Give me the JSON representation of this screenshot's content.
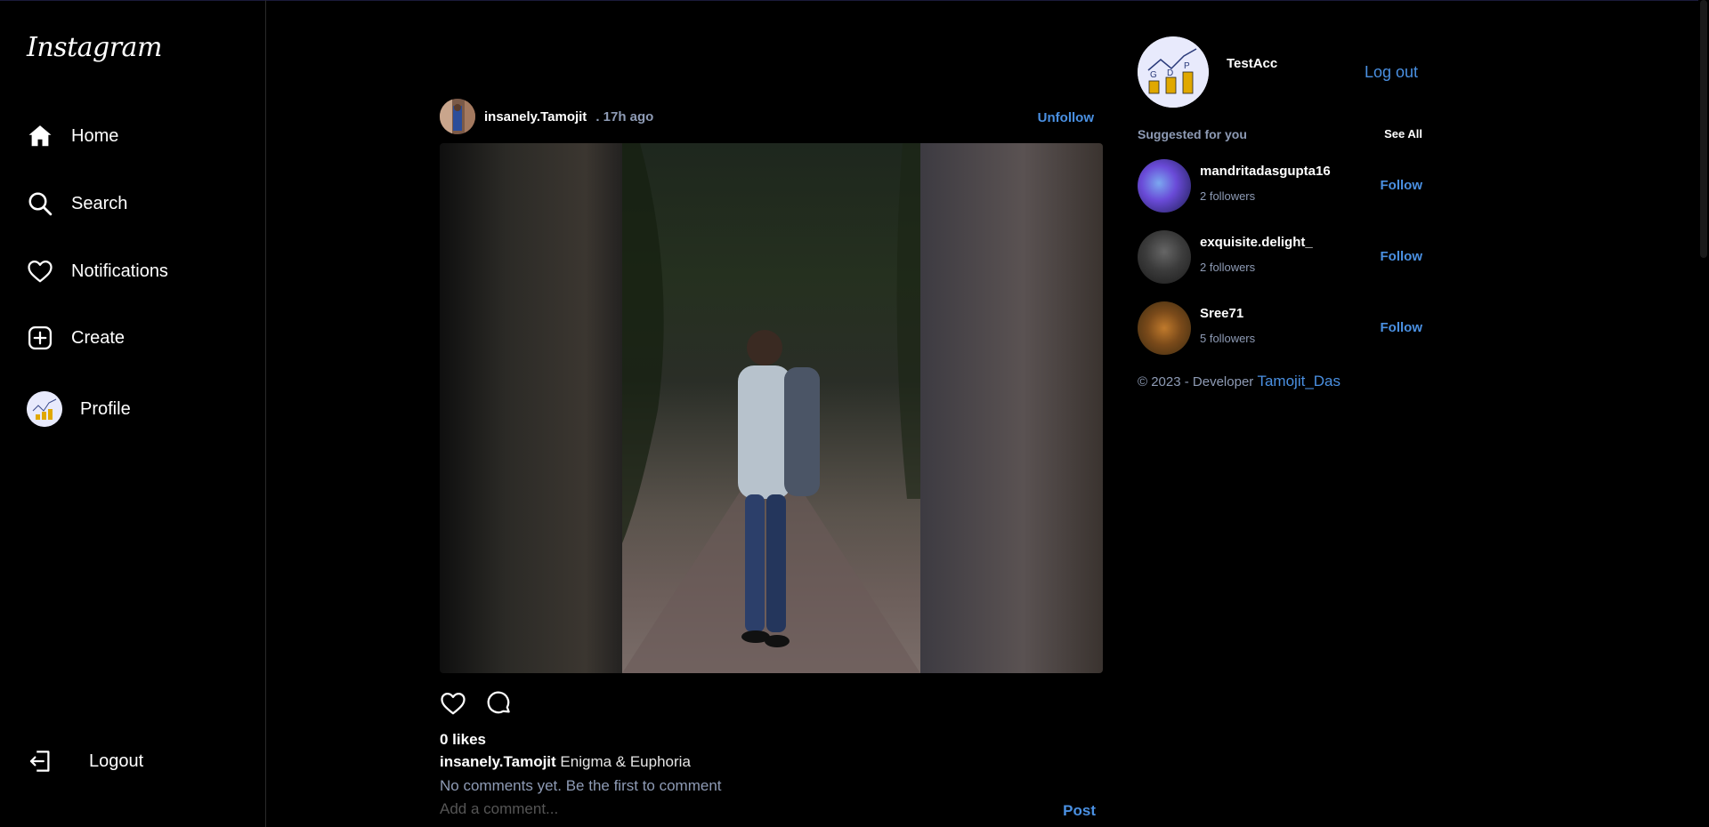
{
  "app": {
    "logo": "Instagram"
  },
  "sidebar": {
    "items": [
      {
        "label": "Home",
        "icon": "home-icon"
      },
      {
        "label": "Search",
        "icon": "search-icon"
      },
      {
        "label": "Notifications",
        "icon": "heart-icon"
      },
      {
        "label": "Create",
        "icon": "plus-square-icon"
      },
      {
        "label": "Profile",
        "icon": "avatar"
      }
    ],
    "logout": {
      "label": "Logout",
      "icon": "logout-icon"
    }
  },
  "post": {
    "username": "insanely.Tamojit",
    "time": ". 17h ago",
    "unfollow_label": "Unfollow",
    "likes": "0 likes",
    "caption_user": "insanely.Tamojit",
    "caption_text": "Enigma & Euphoria",
    "no_comments": "No comments yet. Be the first to comment",
    "comment_placeholder": "Add a comment...",
    "post_label": "Post"
  },
  "right": {
    "me": {
      "name": "TestAcc",
      "logout_label": "Log out"
    },
    "suggest_title": "Suggested for you",
    "see_all": "See All",
    "suggestions": [
      {
        "name": "mandritadasgupta16",
        "followers": "2 followers",
        "follow_label": "Follow"
      },
      {
        "name": "exquisite.delight_",
        "followers": "2 followers",
        "follow_label": "Follow"
      },
      {
        "name": "Sree71",
        "followers": "5 followers",
        "follow_label": "Follow"
      }
    ],
    "copyright": "© 2023 - Developer ",
    "developer": "Tamojit_Das"
  },
  "colors": {
    "accent": "#4a90e2",
    "muted": "#8e9bb5",
    "background": "#000000"
  }
}
